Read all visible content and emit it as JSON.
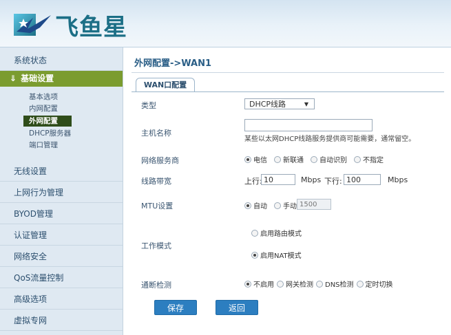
{
  "brand": {
    "name": "飞鱼星"
  },
  "sidebar": {
    "items_top": [
      {
        "label": "系统状态"
      }
    ],
    "group": {
      "label": "基础设置",
      "toggle_icon": "double-chevron-down-icon"
    },
    "subitems": [
      {
        "label": "基本选项"
      },
      {
        "label": "内网配置"
      },
      {
        "label": "外网配置",
        "active": true
      },
      {
        "label": "DHCP服务器"
      },
      {
        "label": "端口管理"
      }
    ],
    "items_bottom": [
      {
        "label": "无线设置"
      },
      {
        "label": "上网行为管理"
      },
      {
        "label": "BYOD管理"
      },
      {
        "label": "认证管理"
      },
      {
        "label": "网络安全"
      },
      {
        "label": "QoS流量控制"
      },
      {
        "label": "高级选项"
      },
      {
        "label": "虚拟专网"
      }
    ]
  },
  "main": {
    "breadcrumb": "外网配置->WAN1",
    "tab": "WAN口配置",
    "fields": {
      "type": {
        "label": "类型",
        "value": "DHCP线路"
      },
      "hostname": {
        "label": "主机名称",
        "value": "",
        "hint": "某些以太网DHCP线路服务提供商可能需要，通常留空。"
      },
      "isp": {
        "label": "网络服务商",
        "options": [
          "电信",
          "新联通",
          "自动识别",
          "不指定"
        ],
        "selected": "电信"
      },
      "bandwidth": {
        "label": "线路带宽",
        "up_label": "上行:",
        "up_value": "10",
        "up_unit": "Mbps",
        "down_label": "下行:",
        "down_value": "100",
        "down_unit": "Mbps"
      },
      "mtu": {
        "label": "MTU设置",
        "options": [
          "自动",
          "手动"
        ],
        "selected": "自动",
        "value": "1500"
      },
      "mode": {
        "label": "工作模式",
        "options": [
          "启用路由模式",
          "启用NAT模式"
        ],
        "selected": "启用NAT模式"
      },
      "detect": {
        "label": "通断检测",
        "options": [
          "不启用",
          "网关检测",
          "DNS检测",
          "定时切换"
        ],
        "selected": "不启用"
      }
    },
    "buttons": {
      "save": "保存",
      "back": "返回"
    }
  },
  "colors": {
    "accent_green": "#7b9c2f",
    "active_item": "#2f4d1a",
    "button_blue": "#2c7ec0",
    "sidebar_bg": "#dfe9f2"
  }
}
